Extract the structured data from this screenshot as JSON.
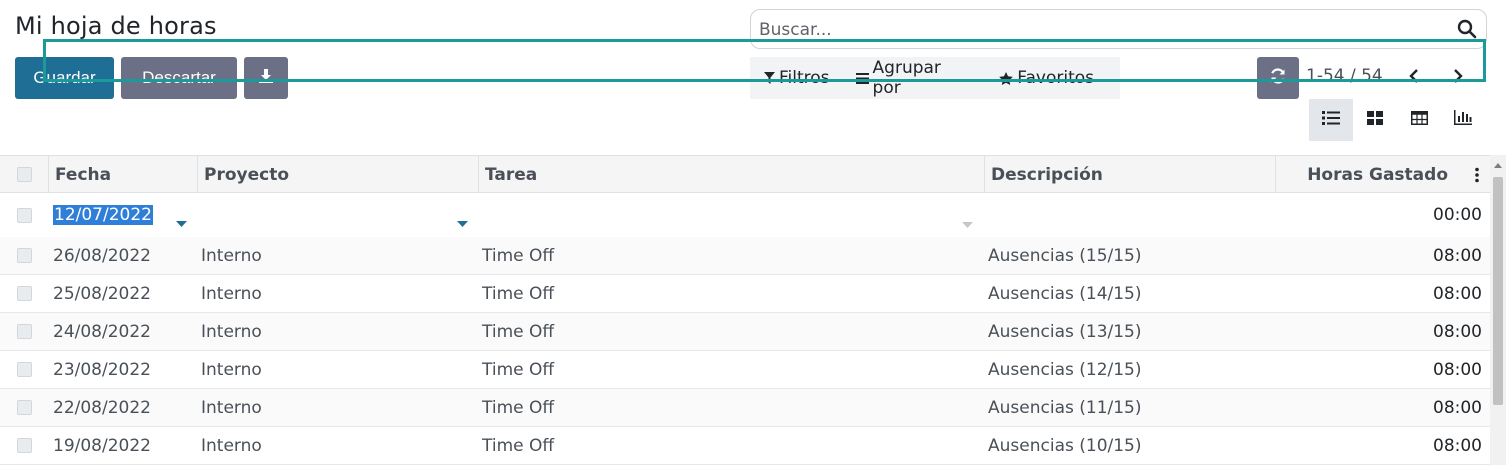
{
  "page": {
    "title": "Mi hoja de horas"
  },
  "actions": {
    "save_label": "Guardar",
    "discard_label": "Descartar",
    "download_icon": "download-icon"
  },
  "search": {
    "placeholder": "Buscar...",
    "icon": "search-icon"
  },
  "filters": {
    "filters_label": "Filtros",
    "group_label": "Agrupar por",
    "favorites_label": "Favoritos"
  },
  "pager": {
    "range": "1-54 / 54"
  },
  "views": [
    "list-view-icon",
    "kanban-view-icon",
    "grid-view-icon",
    "graph-view-icon"
  ],
  "colors": {
    "primary": "#1f6e96",
    "secondary": "#6b7087",
    "edit_border": "#1a9a98",
    "selection": "#2f7fd8"
  },
  "table": {
    "headers": {
      "date": "Fecha",
      "project": "Proyecto",
      "task": "Tarea",
      "description": "Descripción",
      "hours": "Horas Gastado"
    },
    "edit_row": {
      "date": "12/07/2022",
      "project": "",
      "task": "",
      "description": "",
      "hours": "00:00"
    },
    "rows": [
      {
        "date": "26/08/2022",
        "project": "Interno",
        "task": "Time Off",
        "description": "Ausencias (15/15)",
        "hours": "08:00"
      },
      {
        "date": "25/08/2022",
        "project": "Interno",
        "task": "Time Off",
        "description": "Ausencias (14/15)",
        "hours": "08:00"
      },
      {
        "date": "24/08/2022",
        "project": "Interno",
        "task": "Time Off",
        "description": "Ausencias (13/15)",
        "hours": "08:00"
      },
      {
        "date": "23/08/2022",
        "project": "Interno",
        "task": "Time Off",
        "description": "Ausencias (12/15)",
        "hours": "08:00"
      },
      {
        "date": "22/08/2022",
        "project": "Interno",
        "task": "Time Off",
        "description": "Ausencias (11/15)",
        "hours": "08:00"
      },
      {
        "date": "19/08/2022",
        "project": "Interno",
        "task": "Time Off",
        "description": "Ausencias (10/15)",
        "hours": "08:00"
      }
    ]
  }
}
